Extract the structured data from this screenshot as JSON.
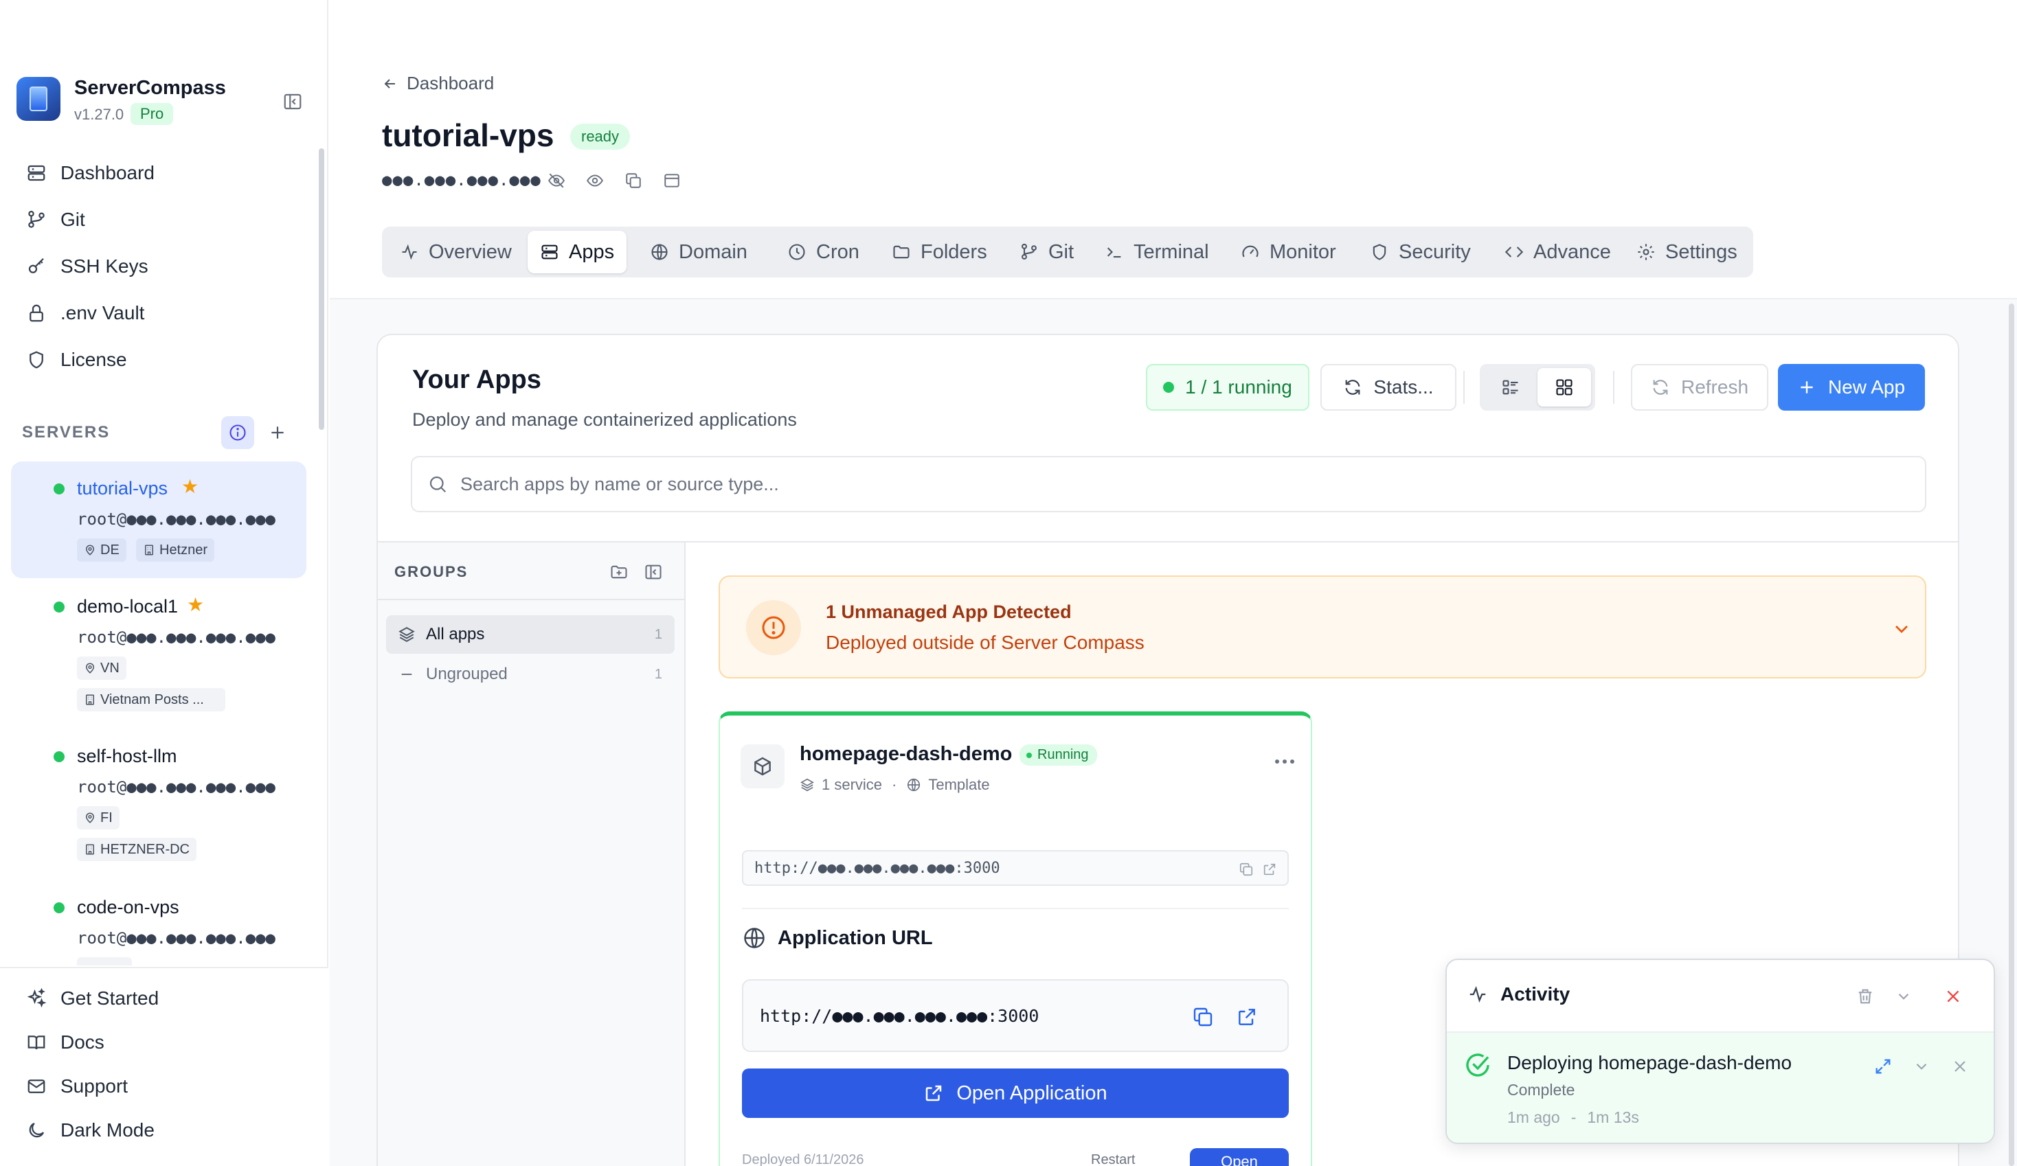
{
  "sidebar": {
    "brand_name": "ServerCompass",
    "version": "v1.27.0",
    "plan_badge": "Pro",
    "nav": [
      {
        "label": "Dashboard",
        "icon": "server-stack-icon"
      },
      {
        "label": "Git",
        "icon": "git-branch-icon"
      },
      {
        "label": "SSH Keys",
        "icon": "key-icon"
      },
      {
        "label": ".env Vault",
        "icon": "lock-icon"
      },
      {
        "label": "License",
        "icon": "shield-icon"
      }
    ],
    "servers_label": "SERVERS",
    "servers": [
      {
        "name": "tutorial-vps",
        "starred": true,
        "user": "root@●●●.●●●.●●●.●●●",
        "tags": [
          "DE",
          "Hetzner"
        ],
        "status": "online",
        "active": true
      },
      {
        "name": "demo-local1",
        "starred": true,
        "user": "root@●●●.●●●.●●●.●●●",
        "tags": [
          "VN",
          "Vietnam Posts ..."
        ],
        "status": "online",
        "active": false
      },
      {
        "name": "self-host-llm",
        "starred": false,
        "user": "root@●●●.●●●.●●●.●●●",
        "tags": [
          "FI",
          "HETZNER-DC"
        ],
        "status": "online",
        "active": false
      },
      {
        "name": "code-on-vps",
        "starred": false,
        "user": "root@●●●.●●●.●●●.●●●",
        "tags": [],
        "status": "online",
        "active": false
      }
    ],
    "bottom_nav": [
      {
        "label": "Get Started",
        "icon": "sparkles-icon"
      },
      {
        "label": "Docs",
        "icon": "book-icon"
      },
      {
        "label": "Support",
        "icon": "mail-icon"
      },
      {
        "label": "Dark Mode",
        "icon": "moon-icon"
      }
    ]
  },
  "header": {
    "back_label": "Dashboard",
    "title": "tutorial-vps",
    "status_badge": "ready",
    "ip_masked": "●●●.●●●.●●●.●●●",
    "tabs": [
      {
        "label": "Overview",
        "icon": "activity-icon",
        "active": false
      },
      {
        "label": "Apps",
        "icon": "server-stack-icon",
        "active": true
      },
      {
        "label": "Domain",
        "icon": "globe-icon",
        "active": false
      },
      {
        "label": "Cron",
        "icon": "clock-icon",
        "active": false
      },
      {
        "label": "Folders",
        "icon": "folder-icon",
        "active": false
      },
      {
        "label": "Git",
        "icon": "git-branch-icon",
        "active": false
      },
      {
        "label": "Terminal",
        "icon": "terminal-icon",
        "active": false
      },
      {
        "label": "Monitor",
        "icon": "gauge-icon",
        "active": false
      },
      {
        "label": "Security",
        "icon": "shield-icon",
        "active": false
      },
      {
        "label": "Advance",
        "icon": "code-icon",
        "active": false
      },
      {
        "label": "Settings",
        "icon": "gear-icon",
        "active": false
      }
    ]
  },
  "apps_panel": {
    "title": "Your Apps",
    "subtitle": "Deploy and manage containerized applications",
    "running_status": "1 / 1 running",
    "stats_label": "Stats...",
    "refresh_label": "Refresh",
    "new_app_label": "New App",
    "view_mode": "grid",
    "search_placeholder": "Search apps by name or source type...",
    "search_value": ""
  },
  "groups": {
    "label": "GROUPS",
    "items": [
      {
        "label": "All apps",
        "count": "1",
        "active": true
      },
      {
        "label": "Ungrouped",
        "count": "1",
        "active": false
      }
    ]
  },
  "unmanaged": {
    "title": "1 Unmanaged App Detected",
    "subtitle": "Deployed outside of Server Compass"
  },
  "app_card": {
    "name": "homepage-dash-demo",
    "status": "Running",
    "services": "1 service",
    "source": "Template",
    "internal_url": "http://●●●.●●●.●●●.●●●:3000",
    "app_url_label": "Application URL",
    "app_url": "http://●●●.●●●.●●●.●●●:3000",
    "open_label": "Open Application",
    "footer_deployed": "Deployed 6/11/2026",
    "footer_restart": "Restart",
    "footer_open": "Open"
  },
  "activity": {
    "title": "Activity",
    "item_title": "Deploying homepage-dash-demo",
    "item_status": "Complete",
    "item_time": "1m ago",
    "item_duration": "1m 13s"
  },
  "colors": {
    "accent": "#3b82f6",
    "primary_button": "#2d5be3",
    "running_green": "#22c55e",
    "warning_orange": "#ea580c",
    "star": "#f59e0b"
  }
}
